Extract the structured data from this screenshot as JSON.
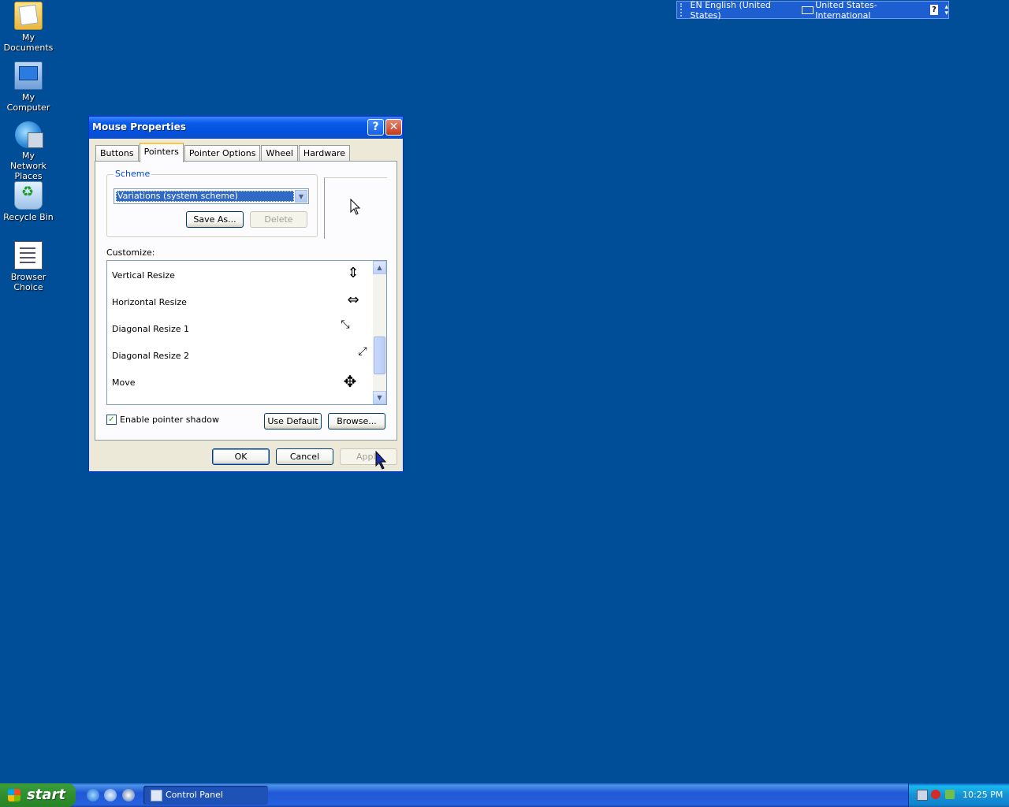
{
  "desktop": {
    "icons": [
      {
        "label": "My Documents"
      },
      {
        "label": "My Computer"
      },
      {
        "label": "My Network Places"
      },
      {
        "label": "Recycle Bin"
      },
      {
        "label": "Browser Choice"
      }
    ]
  },
  "language_bar": {
    "language": "EN English (United States)",
    "keyboard": "United States-International",
    "help_label": "?"
  },
  "dialog": {
    "title": "Mouse Properties",
    "help_btn": "?",
    "close_btn": "✕",
    "tabs": [
      "Buttons",
      "Pointers",
      "Pointer Options",
      "Wheel",
      "Hardware"
    ],
    "active_tab": "Pointers",
    "scheme": {
      "group_label": "Scheme",
      "selected": "Variations (system scheme)",
      "save_as": "Save As...",
      "delete": "Delete"
    },
    "customize": {
      "label": "Customize:",
      "items": [
        {
          "name": "Vertical Resize",
          "icon": "vertical-resize-icon",
          "glyph": "⇕"
        },
        {
          "name": "Horizontal Resize",
          "icon": "horizontal-resize-icon",
          "glyph": "⇔"
        },
        {
          "name": "Diagonal Resize 1",
          "icon": "diagonal-resize-1-icon",
          "glyph": "⤡"
        },
        {
          "name": "Diagonal Resize 2",
          "icon": "diagonal-resize-2-icon",
          "glyph": "⤢"
        },
        {
          "name": "Move",
          "icon": "move-icon",
          "glyph": "✥"
        }
      ]
    },
    "enable_shadow": {
      "label": "Enable pointer shadow",
      "checked": true
    },
    "use_default": "Use Default",
    "browse": "Browse...",
    "ok": "OK",
    "cancel": "Cancel",
    "apply": "Apply"
  },
  "taskbar": {
    "start_label": "start",
    "tasks": [
      {
        "label": "Control Panel"
      }
    ],
    "clock": "10:25 PM"
  },
  "colors": {
    "desktop": "#004e98",
    "titlebar": "#0350de",
    "taskbar": "#2157d7",
    "start_button": "#2f8f2f",
    "selection": "#316ac5"
  }
}
